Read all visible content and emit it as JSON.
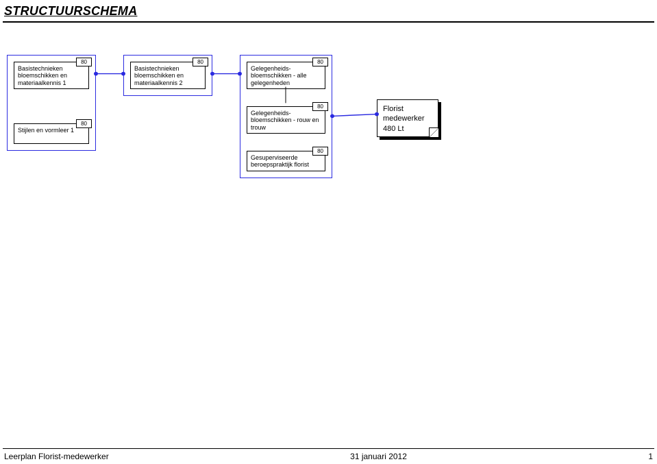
{
  "title": "STRUCTUURSCHEMA",
  "footer": {
    "left": "Leerplan Florist-medewerker",
    "center": "31 januari 2012",
    "right": "1"
  },
  "boxes": {
    "b1": {
      "label": "Basistechnieken bloemschikken en materiaalkennis 1",
      "value": "80"
    },
    "b2": {
      "label": "Stijlen en vormleer 1",
      "value": "80"
    },
    "b3": {
      "label": "Basistechnieken bloemschikken en materiaalkennis 2",
      "value": "80"
    },
    "b4": {
      "label": "Gelegenheids-bloemschikken - alle gelegenheden",
      "value": "80"
    },
    "b5": {
      "label": "Gelegenheids-bloemschikken - rouw en trouw",
      "value": "80"
    },
    "b6": {
      "label": "Gesuperviseerde beroepspraktijk florist",
      "value": "80"
    }
  },
  "terminal": {
    "line1": "Florist",
    "line2": "medewerker",
    "line3": "480 Lt"
  }
}
